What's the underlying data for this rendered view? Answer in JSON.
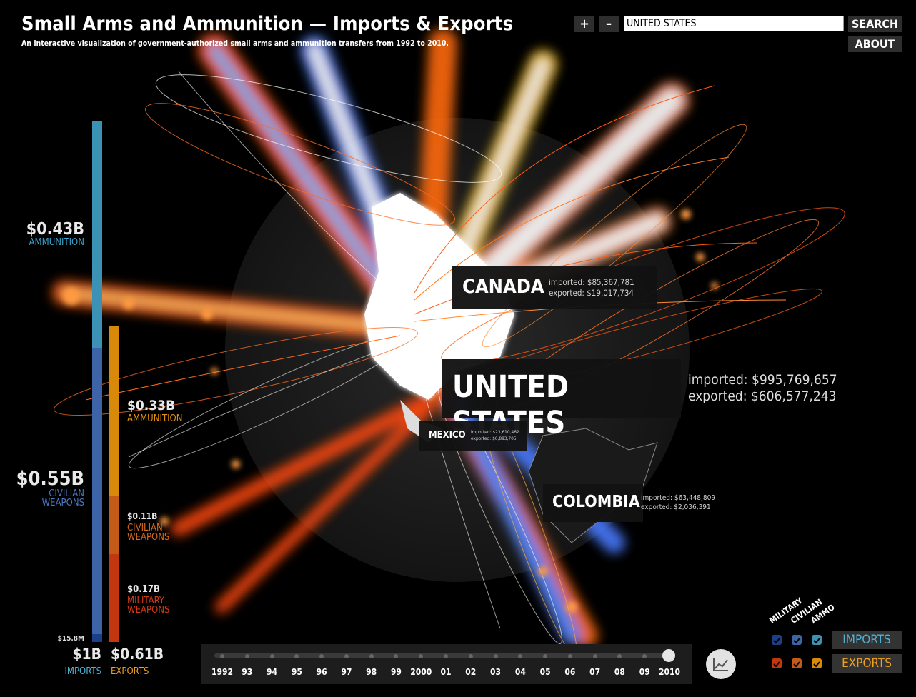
{
  "app": {
    "title": "Small Arms and Ammunition — Imports & Exports",
    "subtitle": "An interactive visualization of government-authorized small arms and ammunition transfers from 1992 to 2010."
  },
  "controls": {
    "zoom_in": "+",
    "zoom_out": "–",
    "search_value": "UNITED STATES",
    "search_button": "SEARCH",
    "about_button": "ABOUT"
  },
  "imports_bar": {
    "ammunition_value": "$0.43B",
    "ammunition_label": "AMMUNITION",
    "civilian_value": "$0.55B",
    "civilian_label_1": "CIVILIAN",
    "civilian_label_2": "WEAPONS",
    "military_value": "$15.8M",
    "total_value": "$1B",
    "total_label": "IMPORTS"
  },
  "exports_bar": {
    "ammunition_value": "$0.33B",
    "ammunition_label": "AMMUNITION",
    "civilian_value": "$0.11B",
    "civilian_label_1": "CIVILIAN",
    "civilian_label_2": "WEAPONS",
    "military_value": "$0.17B",
    "military_label_1": "MILITARY",
    "military_label_2": "WEAPONS",
    "total_value": "$0.61B",
    "total_label": "EXPORTS"
  },
  "countries": {
    "canada": {
      "name": "CANADA",
      "imported": "imported: $85,367,781",
      "exported": "exported: $19,017,734"
    },
    "united_states": {
      "name": "UNITED STATES",
      "imported": "imported: $995,769,657",
      "exported": "exported: $606,577,243"
    },
    "mexico": {
      "name": "MEXICO",
      "imported": "imported: $23,610,462",
      "exported": "exported: $6,893,705"
    },
    "colombia": {
      "name": "COLOMBIA",
      "imported": "imported: $63,448,809",
      "exported": "exported: $2,036,391"
    }
  },
  "timeline": {
    "years": [
      "1992",
      "93",
      "94",
      "95",
      "96",
      "97",
      "98",
      "99",
      "2000",
      "01",
      "02",
      "03",
      "04",
      "05",
      "06",
      "07",
      "08",
      "09",
      "2010"
    ],
    "selected": "2010"
  },
  "legend": {
    "headers": [
      "MILITARY",
      "CIVILIAN",
      "AMMO"
    ],
    "imports_button": "IMPORTS",
    "exports_button": "EXPORTS"
  },
  "colors": {
    "imports_ammunition": "#3c92b4",
    "imports_civilian": "#3e64a8",
    "imports_military": "#1c3f8a",
    "exports_ammunition": "#d9890a",
    "exports_civilian": "#c45a18",
    "exports_military": "#c23610",
    "imports_text": "#4fb1d4",
    "exports_text": "#f0a020"
  }
}
